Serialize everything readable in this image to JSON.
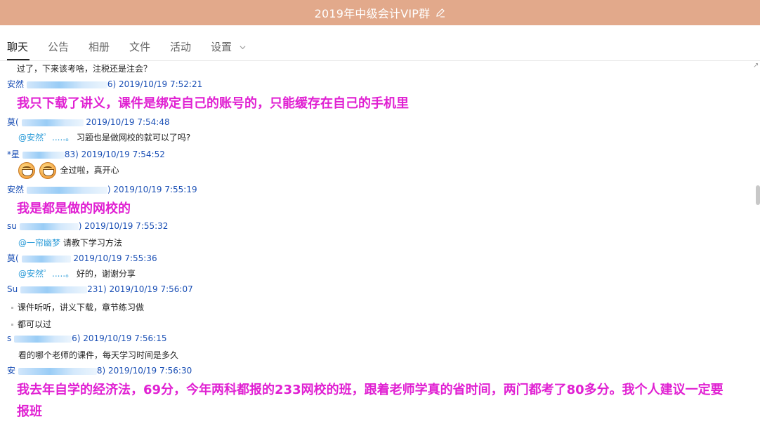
{
  "window": {
    "title": "2019年中级会计VIP群"
  },
  "tabs": [
    {
      "label": "聊天"
    },
    {
      "label": "公告"
    },
    {
      "label": "相册"
    },
    {
      "label": "文件"
    },
    {
      "label": "活动"
    },
    {
      "label": "设置"
    }
  ],
  "messages": {
    "m0": {
      "text": "过了，下来该考啥，注税还是注会？"
    },
    "m1": {
      "sender_a": "安然",
      "sender_b": "6)",
      "time": "2019/10/19 7:52:21",
      "text": "我只下载了讲义，课件是绑定自己的账号的，只能缓存在自己的手机里"
    },
    "m2": {
      "sender_a": "莫(",
      "time": "2019/10/19 7:54:48",
      "mention": "@安然゜.....。",
      "text": "习题也是做网校的就可以了吗?"
    },
    "m3": {
      "sender_a": "*星",
      "sender_b": "83)",
      "time": "2019/10/19 7:54:52",
      "text": "全过啦，真开心"
    },
    "m4": {
      "sender_a": "安然",
      "sender_b": ")",
      "time": "2019/10/19 7:55:19",
      "text": "我是都是做的网校的"
    },
    "m5": {
      "sender_a": "su",
      "sender_b": ")",
      "time": "2019/10/19 7:55:32",
      "mention": "@一帘幽梦",
      "text": "请教下学习方法"
    },
    "m6": {
      "sender_a": "莫(",
      "time": "2019/10/19 7:55:36",
      "mention": "@安然゜.....。",
      "text": "好的，谢谢分享"
    },
    "m7": {
      "sender_a": "Su",
      "sender_b": "231)",
      "time": "2019/10/19 7:56:07",
      "text": "课件听听，讲义下载，章节练习做",
      "text2": "都可以过"
    },
    "m8": {
      "sender_a": "s",
      "sender_b": "6)",
      "time": "2019/10/19 7:56:15",
      "text": "看的哪个老师的课件，每天学习时间是多久"
    },
    "m9": {
      "sender_a": "安",
      "sender_b": "8)",
      "time": "2019/10/19 7:56:30",
      "text": "我去年自学的经济法，69分，今年两科都报的233网校的班，跟着老师学真的省时间，两门都考了80多分。我个人建议一定要",
      "text2": "报班"
    }
  }
}
